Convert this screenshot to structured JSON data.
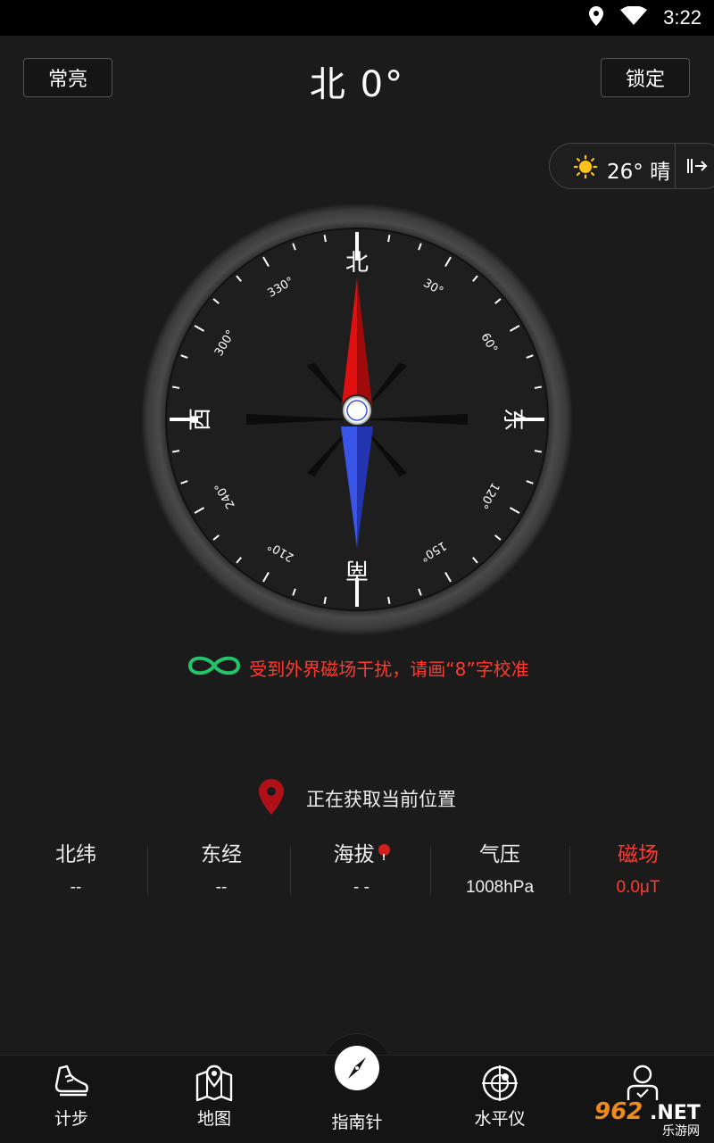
{
  "status_bar": {
    "time": "3:22"
  },
  "header": {
    "left_button": "常亮",
    "title": "北 0°",
    "right_button": "锁定"
  },
  "weather": {
    "text": "26° 晴"
  },
  "compass": {
    "north": "北",
    "east": "东",
    "south": "南",
    "west": "西",
    "degree_labels": [
      "30°",
      "60°",
      "120°",
      "150°",
      "210°",
      "240°",
      "300°",
      "330°"
    ]
  },
  "calibration": {
    "message": "受到外界磁场干扰，请画“8”字校准"
  },
  "location": {
    "status": "正在获取当前位置"
  },
  "stats": [
    {
      "label": "北纬",
      "value": "--"
    },
    {
      "label": "东经",
      "value": "--"
    },
    {
      "label": "海拔",
      "value": "- -"
    },
    {
      "label": "气压",
      "value": "1008hPa"
    },
    {
      "label": "磁场",
      "value": "0.0μT"
    }
  ],
  "bottom_nav": [
    {
      "label": "计步",
      "icon": "shoe-icon"
    },
    {
      "label": "地图",
      "icon": "map-pin-icon"
    },
    {
      "label": "指南针",
      "icon": "compass-icon"
    },
    {
      "label": "水平仪",
      "icon": "level-icon"
    },
    {
      "label": "",
      "icon": "person-icon"
    }
  ],
  "watermark": {
    "text": "962.NET",
    "subtext": "乐游网"
  },
  "colors": {
    "accent_red": "#ff3b30",
    "needle_red": "#e01010",
    "needle_blue": "#3a56e8",
    "infinity_green": "#23c36a"
  }
}
